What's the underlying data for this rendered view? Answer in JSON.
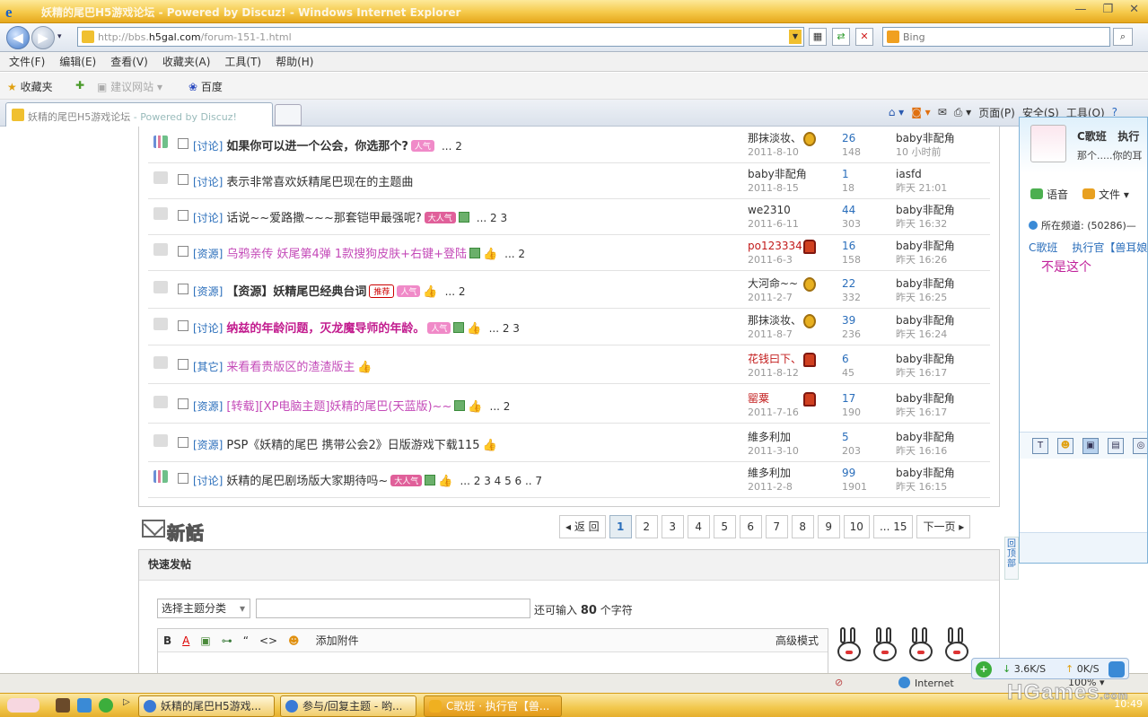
{
  "window": {
    "title": "妖精的尾巴H5游戏论坛 - Powered by Discuz! - Windows Internet Explorer",
    "url_prefix": "http://bbs.",
    "url_domain": "h5gal.com",
    "url_suffix": "/forum-151-1.html",
    "search_placeholder": "Bing"
  },
  "menu": [
    "文件(F)",
    "编辑(E)",
    "查看(V)",
    "收藏夹(A)",
    "工具(T)",
    "帮助(H)"
  ],
  "favorites": {
    "label": "收藏夹",
    "hidden_item": "建议网站",
    "baidu": "百度"
  },
  "tab": {
    "title": "妖精的尾巴H5游戏论坛",
    "suffix": " - Powered by Discuz!"
  },
  "commands": [
    "页面(P)",
    "安全(S)",
    "工具(O)"
  ],
  "threads": [
    {
      "category": "[讨论]",
      "title": "如果你可以进一个公会，你选那个?",
      "style": "bold",
      "badges": [
        "人气"
      ],
      "img": false,
      "thumb": false,
      "pages": "... 2",
      "author": "那抹淡妆、",
      "author_red": false,
      "medal": "gold",
      "date": "2011-8-10",
      "replies": "26",
      "views": "148",
      "last_user": "baby非配角",
      "last_time": "10 小时前",
      "hot_icon": true
    },
    {
      "category": "[讨论]",
      "title": "表示非常喜欢妖精尾巴现在的主题曲",
      "style": "normal",
      "badges": [],
      "img": false,
      "thumb": false,
      "pages": "",
      "author": "baby非配角",
      "author_red": false,
      "medal": "",
      "date": "2011-8-15",
      "replies": "1",
      "views": "18",
      "last_user": "iasfd",
      "last_time": "昨天 21:01",
      "hot_icon": false
    },
    {
      "category": "[讨论]",
      "title": "话说~~爱路撒~~~那套铠甲最强呢?",
      "style": "normal",
      "badges": [
        "大人气"
      ],
      "img": true,
      "thumb": false,
      "pages": "... 2  3",
      "author": "we2310",
      "author_red": false,
      "medal": "",
      "date": "2011-6-11",
      "replies": "44",
      "views": "303",
      "last_user": "baby非配角",
      "last_time": "昨天 16:32",
      "hot_icon": false
    },
    {
      "category": "[资源]",
      "title": "乌鸦亲传 妖尾第4弹 1款搜狗皮肤+右键+登陆",
      "style": "pink",
      "badges": [],
      "img": true,
      "thumb": true,
      "pages": "... 2",
      "author": "po123334",
      "author_red": true,
      "medal": "fire",
      "date": "2011-6-3",
      "replies": "16",
      "views": "158",
      "last_user": "baby非配角",
      "last_time": "昨天 16:26",
      "hot_icon": false
    },
    {
      "category": "[资源]",
      "title": "【资源】妖精尾巴经典台词",
      "style": "bold",
      "badges": [
        "推荐",
        "人气"
      ],
      "img": false,
      "thumb": true,
      "pages": "... 2",
      "author": "大河命~~",
      "author_red": false,
      "medal": "gold",
      "date": "2011-2-7",
      "replies": "22",
      "views": "332",
      "last_user": "baby非配角",
      "last_time": "昨天 16:25",
      "hot_icon": false
    },
    {
      "category": "[讨论]",
      "title": "纳兹的年龄问题，灭龙魔导师的年龄。",
      "style": "magenta",
      "badges": [
        "人气"
      ],
      "img": true,
      "thumb": true,
      "pages": "... 2  3",
      "author": "那抹淡妆、",
      "author_red": false,
      "medal": "gold",
      "date": "2011-8-7",
      "replies": "39",
      "views": "236",
      "last_user": "baby非配角",
      "last_time": "昨天 16:24",
      "hot_icon": false
    },
    {
      "category": "[其它]",
      "title": "来看看贵版区的渣渣版主",
      "style": "pink",
      "badges": [],
      "img": false,
      "thumb": true,
      "pages": "",
      "author": "花钱曰下、",
      "author_red": true,
      "medal": "fire",
      "date": "2011-8-12",
      "replies": "6",
      "views": "45",
      "last_user": "baby非配角",
      "last_time": "昨天 16:17",
      "hot_icon": false
    },
    {
      "category": "[资源]",
      "title": "[转载][XP电脑主题]妖精的尾巴(天蓝版)~~",
      "style": "pink",
      "badges": [],
      "img": true,
      "thumb": true,
      "pages": "... 2",
      "author": "罂粟",
      "author_red": true,
      "medal": "fire",
      "date": "2011-7-16",
      "replies": "17",
      "views": "190",
      "last_user": "baby非配角",
      "last_time": "昨天 16:17",
      "hot_icon": false
    },
    {
      "category": "[资源]",
      "title": "PSP《妖精的尾巴 携带公会2》日版游戏下载115",
      "style": "normal",
      "badges": [],
      "img": false,
      "thumb": true,
      "pages": "",
      "author": "維多利加",
      "author_red": false,
      "medal": "",
      "date": "2011-3-10",
      "replies": "5",
      "views": "203",
      "last_user": "baby非配角",
      "last_time": "昨天 16:16",
      "hot_icon": false
    },
    {
      "category": "[讨论]",
      "title": "妖精的尾巴剧场版大家期待吗~",
      "style": "normal",
      "badges": [
        "大人气"
      ],
      "img": true,
      "thumb": true,
      "pages": "... 2  3  4  5  6 .. 7",
      "author": "維多利加",
      "author_red": false,
      "medal": "",
      "date": "2011-2-8",
      "replies": "99",
      "views": "1901",
      "last_user": "baby非配角",
      "last_time": "昨天 16:15",
      "hot_icon": true
    }
  ],
  "new_topic": "新話題",
  "pager": {
    "prev": "◂ 返 回",
    "pages": [
      "1",
      "2",
      "3",
      "4",
      "5",
      "6",
      "7",
      "8",
      "9",
      "10",
      "... 15"
    ],
    "current": "1",
    "next": "下一页 ▸"
  },
  "fastpost": {
    "header": "快速发帖",
    "select": "选择主题分类",
    "remain_prefix": "还可输入",
    "remain_count": "80",
    "remain_suffix": "个字符",
    "attach": "添加附件",
    "advanced": "高级模式"
  },
  "scrolltop": "回顶部",
  "qq": {
    "name": "C歌班",
    "name2": "执行",
    "signature": "那个.....你的耳",
    "voice": "语音",
    "file": "文件",
    "channel": "所在频道:",
    "channel_id": "(50286)",
    "members": [
      "C歌班",
      "执行官【兽耳娘"
    ],
    "message": "不是这个"
  },
  "status": {
    "zone": "Internet",
    "zoom": "100%",
    "download": "3.6K/S",
    "upload": "0K/S"
  },
  "taskbar": {
    "items": [
      "妖精的尾巴H5游戏...",
      "参与/回复主题 - 哟...",
      "C歌班 · 执行官【兽..."
    ],
    "clock": "10:49"
  },
  "watermark": "HGames",
  "watermark_small": ".com"
}
